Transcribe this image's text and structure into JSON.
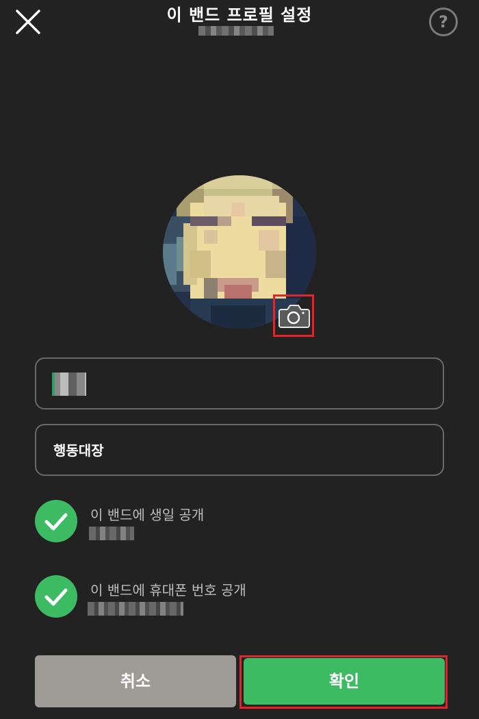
{
  "header": {
    "title": "이 밴드 프로필 설정",
    "close_icon": "close-icon",
    "help_icon": "help-icon",
    "help_glyph": "?"
  },
  "avatar": {
    "camera_icon": "camera-icon"
  },
  "fields": {
    "nickname_value": "행동대장"
  },
  "toggles": [
    {
      "label": "이 밴드에 생일 공개",
      "checked": true
    },
    {
      "label": "이 밴드에 휴대폰 번호 공개",
      "checked": true
    }
  ],
  "buttons": {
    "cancel_label": "취소",
    "confirm_label": "확인"
  },
  "colors": {
    "background": "#222222",
    "accent_green": "#3dbb63",
    "cancel_gray": "#9e9b96",
    "highlight_red": "#e5232a"
  }
}
